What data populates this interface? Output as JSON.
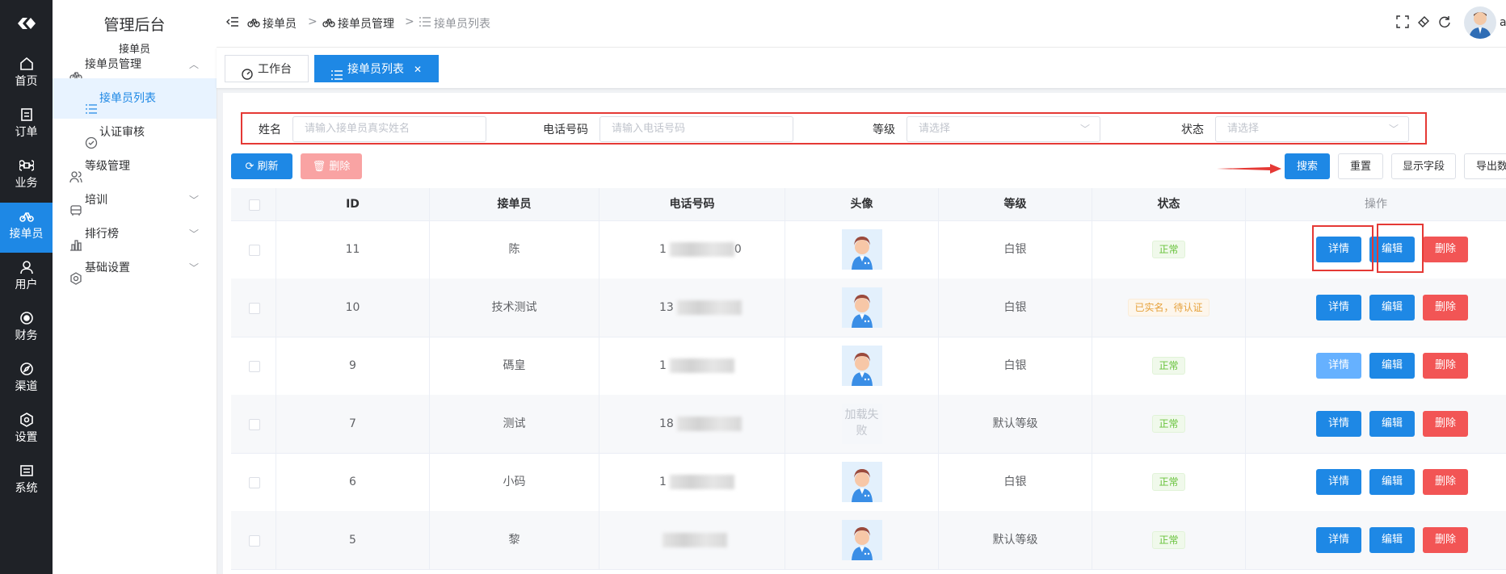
{
  "rail": {
    "items": [
      {
        "label": "首页",
        "icon": "home-icon"
      },
      {
        "label": "订单",
        "icon": "order-icon"
      },
      {
        "label": "业务",
        "icon": "command-icon"
      },
      {
        "label": "接单员",
        "icon": "bike-icon"
      },
      {
        "label": "用户",
        "icon": "user-icon"
      },
      {
        "label": "财务",
        "icon": "finance-icon"
      },
      {
        "label": "渠道",
        "icon": "compass-icon"
      },
      {
        "label": "设置",
        "icon": "settings-icon"
      },
      {
        "label": "系统",
        "icon": "system-icon"
      }
    ],
    "active_index": 3
  },
  "menu": {
    "title": "管理后台",
    "subtitle": "接单员",
    "items": [
      {
        "label": "接单员管理",
        "icon": "bike-icon",
        "chevron": "up"
      },
      {
        "label": "接单员列表",
        "icon": "list-icon",
        "active": true,
        "sub": true
      },
      {
        "label": "认证审核",
        "icon": "check-circle-icon",
        "sub": true
      },
      {
        "label": "等级管理",
        "icon": "users-icon"
      },
      {
        "label": "培训",
        "icon": "bus-icon",
        "chevron": "down"
      },
      {
        "label": "排行榜",
        "icon": "chart-icon",
        "chevron": "down"
      },
      {
        "label": "基础设置",
        "icon": "gear-icon",
        "chevron": "down"
      }
    ]
  },
  "header": {
    "breadcrumb": [
      "接单员",
      "接单员管理",
      "接单员列表"
    ],
    "user_name": "a"
  },
  "tabs": [
    {
      "label": "工作台",
      "icon": "dashboard-icon"
    },
    {
      "label": "接单员列表",
      "icon": "list-icon",
      "active": true
    }
  ],
  "filters": {
    "name_label": "姓名",
    "name_placeholder": "请输入接单员真实姓名",
    "phone_label": "电话号码",
    "phone_placeholder": "请输入电话号码",
    "level_label": "等级",
    "level_placeholder": "请选择",
    "status_label": "状态",
    "status_placeholder": "请选择"
  },
  "toolbar": {
    "refresh": "刷新",
    "delete": "删除",
    "search": "搜索",
    "reset": "重置",
    "columns": "显示字段",
    "export": "导出数据"
  },
  "table": {
    "headers": [
      "ID",
      "接单员",
      "电话号码",
      "头像",
      "等级",
      "状态",
      "操作"
    ],
    "rows": [
      {
        "id": "11",
        "name": "陈",
        "phone": "1",
        "phone_tail": "0",
        "avatar": true,
        "level": "白银",
        "status": "正常",
        "status_type": "success"
      },
      {
        "id": "10",
        "name": "技术测试",
        "phone": "13",
        "phone_tail": "",
        "avatar": true,
        "level": "白银",
        "status": "已实名，待认证",
        "status_type": "warning"
      },
      {
        "id": "9",
        "name": "碼皇",
        "phone": "1",
        "phone_tail": "",
        "avatar": true,
        "level": "白银",
        "status": "正常",
        "status_type": "success"
      },
      {
        "id": "7",
        "name": "测试",
        "phone": "18",
        "phone_tail": "",
        "avatar": false,
        "avatar_fail": "加载失败",
        "level": "默认等级",
        "status": "正常",
        "status_type": "success"
      },
      {
        "id": "6",
        "name": "小码",
        "phone": "1",
        "phone_tail": "",
        "avatar": true,
        "level": "白银",
        "status": "正常",
        "status_type": "success"
      },
      {
        "id": "5",
        "name": "黎",
        "phone": "",
        "phone_tail": "",
        "avatar": true,
        "level": "默认等级",
        "status": "正常",
        "status_type": "success"
      }
    ],
    "actions": {
      "detail": "详情",
      "edit": "编辑",
      "delete": "删除"
    }
  },
  "colors": {
    "primary": "#1e88e5",
    "danger": "#f25555",
    "highlight": "#e53935",
    "rail": "#1f2227"
  }
}
